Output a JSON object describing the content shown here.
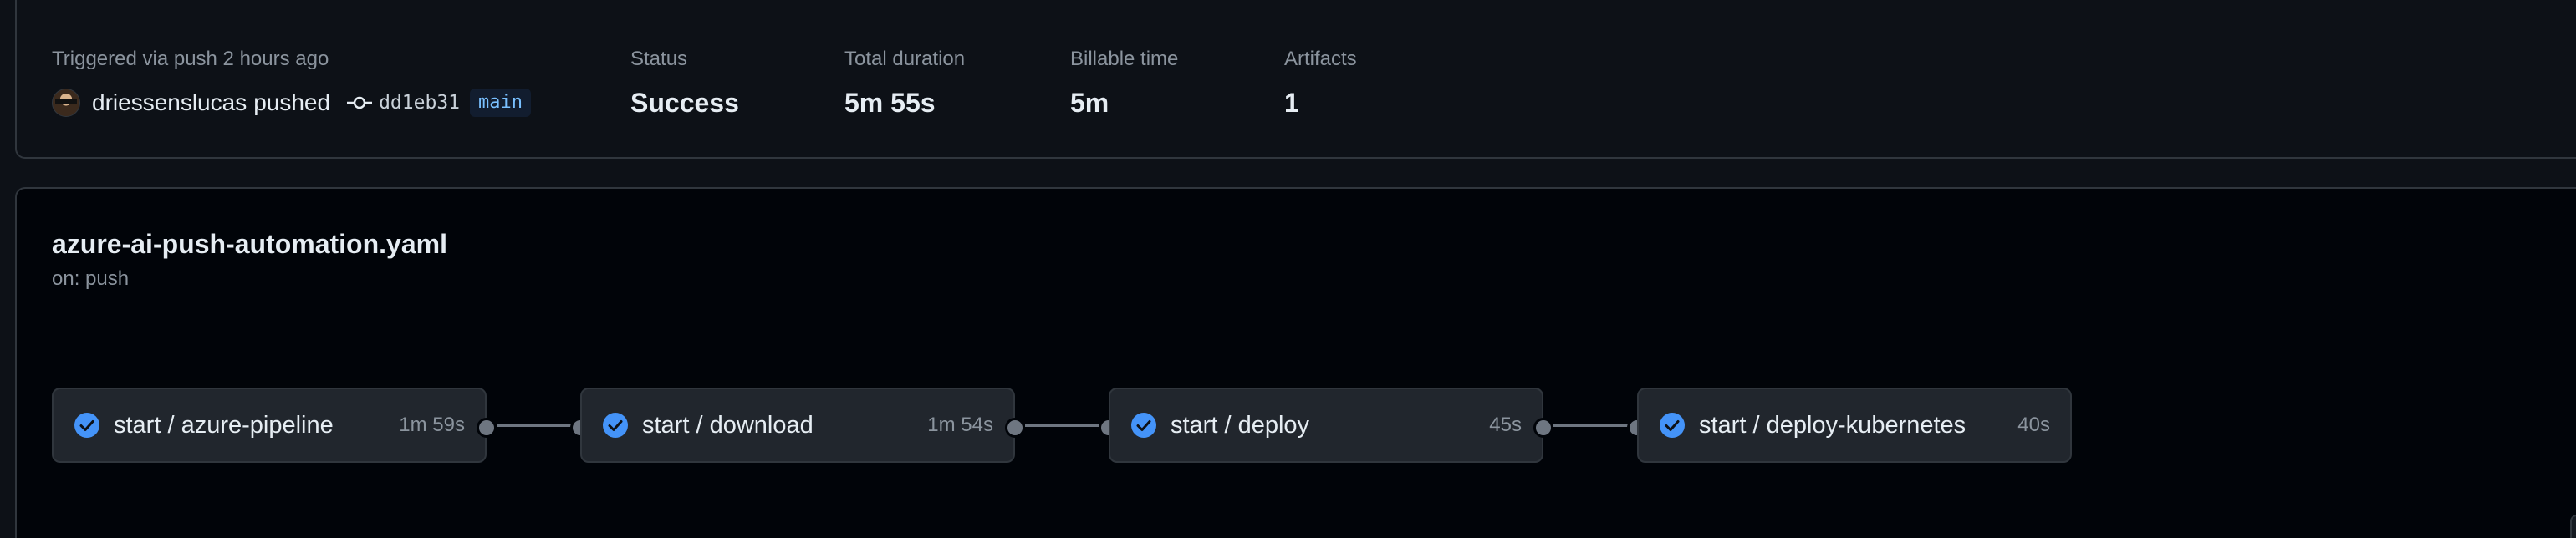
{
  "summary": {
    "trigger_label": "Triggered via push 2 hours ago",
    "actor": "driessenslucas",
    "action": "pushed",
    "commit": "dd1eb31",
    "branch": "main",
    "status_label": "Status",
    "status_value": "Success",
    "duration_label": "Total duration",
    "duration_value": "5m 55s",
    "billable_label": "Billable time",
    "billable_value": "5m",
    "artifacts_label": "Artifacts",
    "artifacts_value": "1"
  },
  "workflow": {
    "name": "azure-ai-push-automation.yaml",
    "trigger": "on: push"
  },
  "jobs": [
    {
      "name": "start / azure-pipeline",
      "duration": "1m 59s",
      "status": "success"
    },
    {
      "name": "start / download",
      "duration": "1m 54s",
      "status": "success"
    },
    {
      "name": "start / deploy",
      "duration": "45s",
      "status": "success"
    },
    {
      "name": "start / deploy-kubernetes",
      "duration": "40s",
      "status": "success"
    }
  ],
  "colors": {
    "background": "#0d1117",
    "canvas": "#010409",
    "card": "#21262d",
    "border": "#30363d",
    "success_check": "#4493f8",
    "muted_text": "#8b949e",
    "branch_text": "#79c0ff"
  },
  "icons": {
    "commit": "git-commit-icon",
    "job_status": "check-circle-fill-icon"
  }
}
